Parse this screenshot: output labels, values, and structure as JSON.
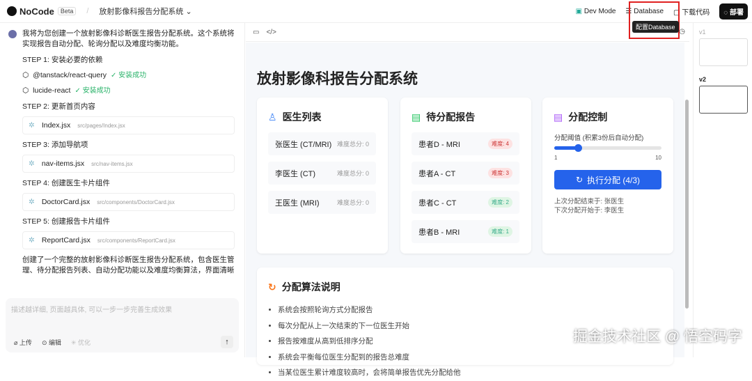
{
  "header": {
    "brand": "NoCode",
    "beta": "Beta",
    "project": "放射影像科报告分配系统",
    "dev_mode": "Dev Mode",
    "database": "Database",
    "database_tooltip": "配置Database",
    "download": "下载代码",
    "deploy": "部署"
  },
  "chat": {
    "intro": "我将为您创建一个放射影像科诊断医生报告分配系统。这个系统将实现报告自动分配、轮询分配以及难度均衡功能。",
    "step1": "STEP 1: 安装必要的依赖",
    "deps": [
      {
        "name": "@tanstack/react-query",
        "status": "安装成功"
      },
      {
        "name": "lucide-react",
        "status": "安装成功"
      }
    ],
    "steps": [
      {
        "label": "STEP 2: 更新首页内容",
        "file": "Index.jsx",
        "path": "src/pages/Index.jsx"
      },
      {
        "label": "STEP 3: 添加导航项",
        "file": "nav-items.jsx",
        "path": "src/nav-items.jsx"
      },
      {
        "label": "STEP 4: 创建医生卡片组件",
        "file": "DoctorCard.jsx",
        "path": "src/components/DoctorCard.jsx"
      },
      {
        "label": "STEP 5: 创建报告卡片组件",
        "file": "ReportCard.jsx",
        "path": "src/components/ReportCard.jsx"
      }
    ],
    "summary": "创建了一个完整的放射影像科诊断医生报告分配系统，包含医生管理、待分配报告列表、自动分配功能以及难度均衡算法，界面清晰直观，操作简便。",
    "placeholder": "描述越详细, 页面越具体, 可以一步一步完善生成效果",
    "upload": "上传",
    "edit": "编辑",
    "optimize": "优化"
  },
  "preview": {
    "title": "放射影像科报告分配系统",
    "doctors": {
      "title": "医生列表",
      "items": [
        {
          "name": "张医生 (CT/MRI)",
          "score": "难度总分: 0"
        },
        {
          "name": "李医生 (CT)",
          "score": "难度总分: 0"
        },
        {
          "name": "王医生 (MRI)",
          "score": "难度总分: 0"
        }
      ]
    },
    "reports": {
      "title": "待分配报告",
      "items": [
        {
          "name": "患者D - MRI",
          "badge": "难度: 4"
        },
        {
          "name": "患者A - CT",
          "badge": "难度: 3"
        },
        {
          "name": "患者C - CT",
          "badge": "难度: 2"
        },
        {
          "name": "患者B - MRI",
          "badge": "难度: 1"
        }
      ]
    },
    "control": {
      "title": "分配控制",
      "label": "分配阈值 (积累3份后自动分配)",
      "min": "1",
      "max": "10",
      "value": 3,
      "button": "执行分配 (4/3)",
      "last": "上次分配结束于: 张医生",
      "next": "下次分配开始于: 李医生"
    },
    "algo": {
      "title": "分配算法说明",
      "items": [
        "系统会按照轮询方式分配报告",
        "每次分配从上一次结束的下一位医生开始",
        "报告按难度从高到低排序分配",
        "系统会平衡每位医生分配到的报告总难度",
        "当某位医生累计难度较高时，会将简单报告优先分配给他"
      ]
    }
  },
  "versions": [
    "v1",
    "v2"
  ],
  "watermark": "掘金技术社区 @ 悟空码字",
  "colors": {
    "primary": "#2563eb",
    "highlight": "#e02020"
  }
}
